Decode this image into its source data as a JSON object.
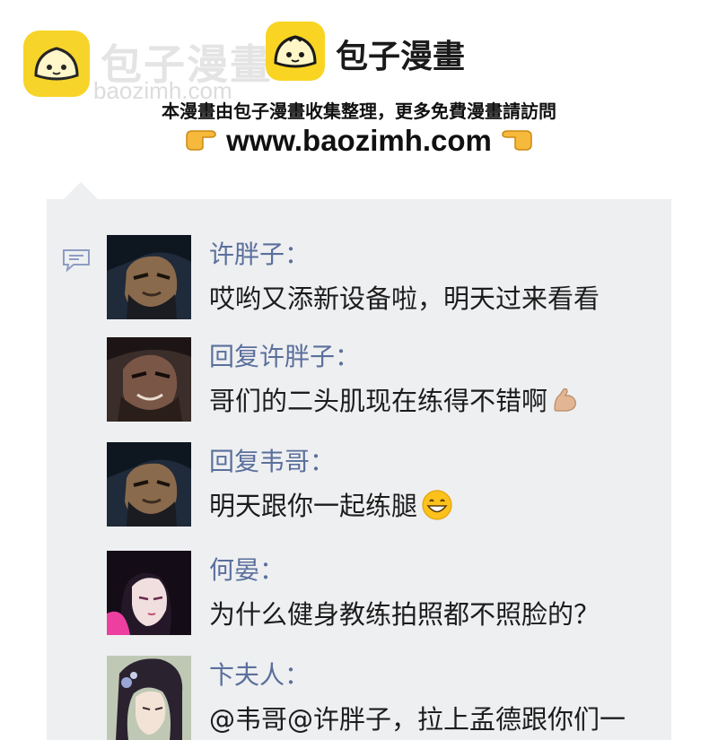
{
  "header": {
    "watermark_title": "包子漫畫",
    "watermark_url": "baozimh.com",
    "brand_title": "包子漫畫",
    "notice": "本漫畫由包子漫畫收集整理，更多免費漫畫請訪問",
    "url": "www.baozimh.com",
    "brand_color": "#f9d423"
  },
  "comments": [
    {
      "name": "许胖子：",
      "text": "哎哟又添新设备啦，明天过来看看",
      "emoji": ""
    },
    {
      "name": "回复许胖子：",
      "text": "哥们的二头肌现在练得不错啊",
      "emoji": "flexed-biceps-icon"
    },
    {
      "name": "回复韦哥：",
      "text": "明天跟你一起练腿",
      "emoji": "grinning-face-icon"
    },
    {
      "name": "何晏：",
      "text": "为什么健身教练拍照都不照脸的？",
      "emoji": ""
    },
    {
      "name": "卞夫人：",
      "text": "@韦哥@许胖子，拉上孟德跟你们一",
      "emoji": ""
    }
  ],
  "colors": {
    "panel_bg": "#eeeff1",
    "name_color": "#5a6f9c",
    "text_color": "#1c1c1c"
  }
}
